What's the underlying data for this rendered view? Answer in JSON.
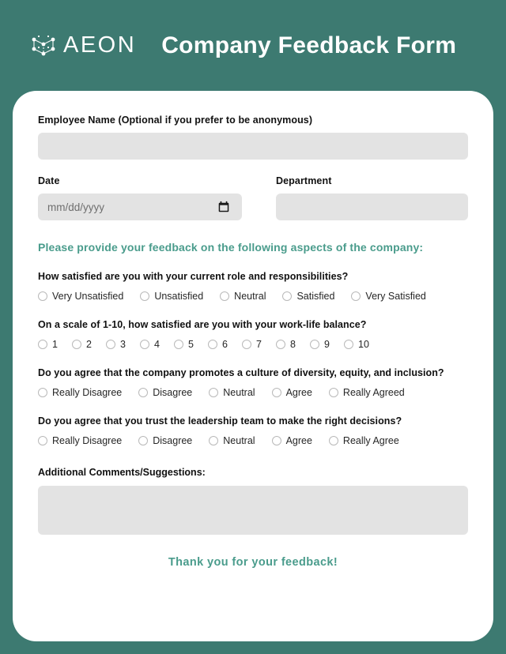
{
  "header": {
    "brand_name": "AEON",
    "brand_icon": "network-nodes-icon",
    "title": "Company Feedback Form",
    "background_color": "#3d7a71"
  },
  "accent_color": "#4a9c8c",
  "form": {
    "employee_name": {
      "label": "Employee Name (Optional if you prefer to be anonymous)",
      "value": "",
      "placeholder": ""
    },
    "date": {
      "label": "Date",
      "value": "",
      "placeholder": "mm/dd/yyyy",
      "icon": "calendar-icon"
    },
    "department": {
      "label": "Department",
      "value": "",
      "placeholder": ""
    },
    "section_heading": "Please provide your feedback on the following aspects of the company:",
    "questions": [
      {
        "text": "How satisfied are you with your current role and responsibilities?",
        "layout": "spread",
        "options": [
          "Very Unsatisfied",
          "Unsatisfied",
          "Neutral",
          "Satisfied",
          "Very Satisfied"
        ]
      },
      {
        "text": "On a scale of 1-10, how satisfied are you with your work-life balance?",
        "layout": "scale",
        "options": [
          "1",
          "2",
          "3",
          "4",
          "5",
          "6",
          "7",
          "8",
          "9",
          "10"
        ]
      },
      {
        "text": "Do you agree that the company promotes a culture of diversity, equity, and inclusion?",
        "layout": "spread",
        "options": [
          "Really Disagree",
          "Disagree",
          "Neutral",
          "Agree",
          "Really Agreed"
        ]
      },
      {
        "text": "Do you agree that you trust the leadership team to make the right decisions?",
        "layout": "spread",
        "options": [
          "Really Disagree",
          "Disagree",
          "Neutral",
          "Agree",
          "Really Agree"
        ]
      }
    ],
    "comments": {
      "label": "Additional Comments/Suggestions:",
      "value": "",
      "placeholder": ""
    },
    "footer_note": "Thank you for your feedback!"
  }
}
